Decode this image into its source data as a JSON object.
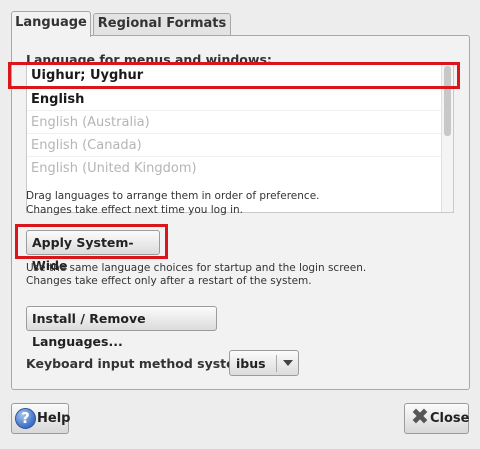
{
  "tabs": [
    {
      "label": "Language",
      "active": true
    },
    {
      "label": "Regional Formats",
      "active": false
    }
  ],
  "language_section": {
    "label": "Language for menus and windows:",
    "items": [
      {
        "label": "Uighur; Uyghur",
        "style": "bold-selected"
      },
      {
        "label": "English",
        "style": "bold"
      },
      {
        "label": "English (Australia)",
        "style": "muted"
      },
      {
        "label": "English (Canada)",
        "style": "muted"
      },
      {
        "label": "English (United Kingdom)",
        "style": "muted"
      }
    ]
  },
  "notes": {
    "drag_line1": "Drag languages to arrange them in order of preference.",
    "drag_line2": "Changes take effect next time you log in.",
    "system_line1": "Use the same language choices for startup and the login screen.",
    "system_line2": "Changes take effect only after a restart of the system."
  },
  "buttons": {
    "apply_system_wide": "Apply System-Wide",
    "install_remove": "Install / Remove Languages...",
    "help": "Help",
    "close": "Close"
  },
  "keyboard": {
    "label": "Keyboard input method system:",
    "value": "ibus"
  },
  "icons": [
    "help-icon",
    "close-icon",
    "dropdown-arrow-icon"
  ],
  "colors": {
    "highlight": "#d8161c"
  }
}
